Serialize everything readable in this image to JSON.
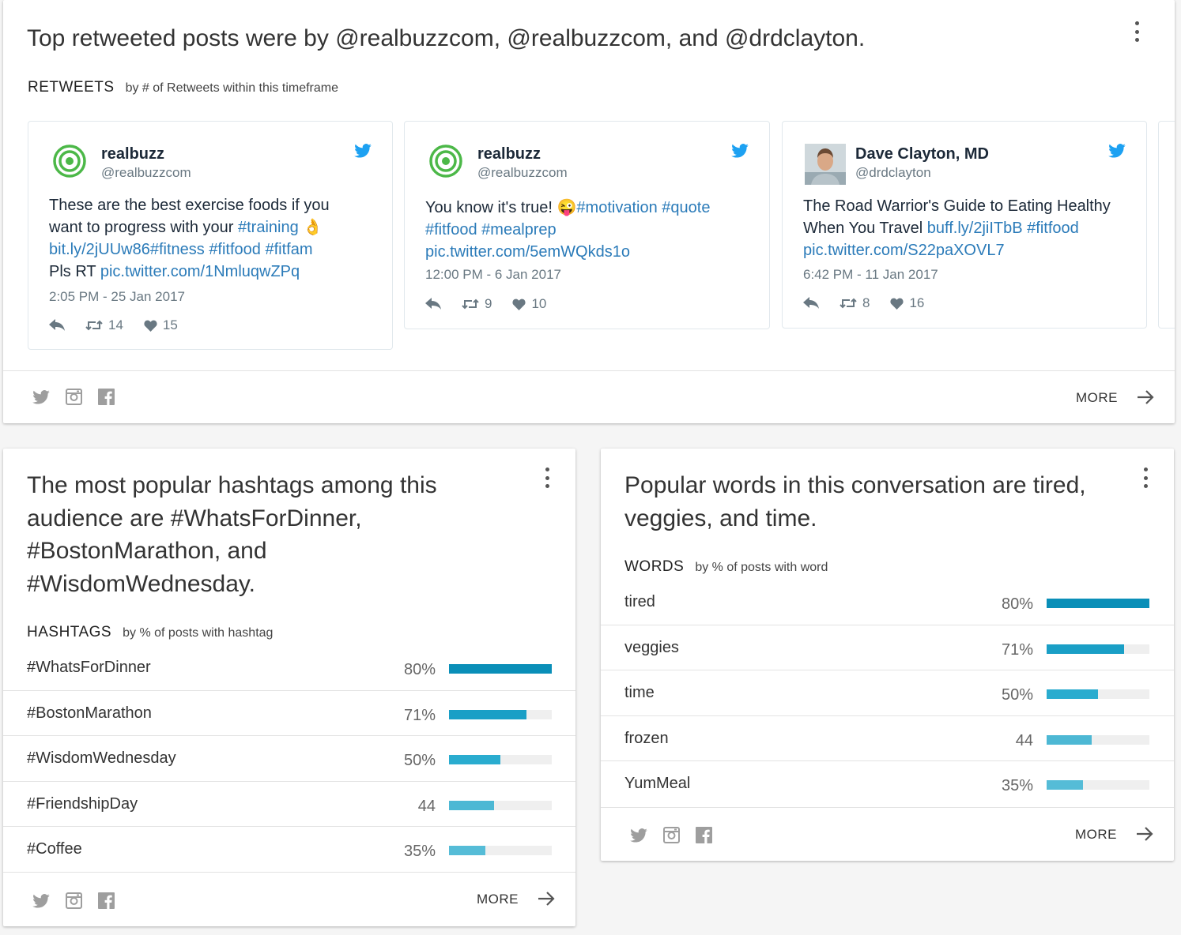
{
  "top_card": {
    "title": "Top retweeted posts were by @realbuzzcom, @realbuzzcom, and @drdclayton.",
    "section_label": "RETWEETS",
    "section_sub": "by # of Retweets within this timeframe",
    "more_label": "MORE",
    "tweets": [
      {
        "name": "realbuzz",
        "handle": "@realbuzzcom",
        "text_plain_1": "These are the best exercise foods if you want to progress with your ",
        "link_1": "#training",
        "emoji": "👌",
        "link_2": "bit.ly/2jUUw86#fitness",
        "link_3": "#fitfood",
        "link_4": "#fitfam",
        "text_plain_2": "Pls RT ",
        "link_5": "pic.twitter.com/1NmluqwZPq",
        "time": "2:05 PM - 25 Jan 2017",
        "retweets": "14",
        "likes": "15"
      },
      {
        "name": "realbuzz",
        "handle": "@realbuzzcom",
        "text_plain_1": "You know it's true! ",
        "emoji": "😜",
        "link_1": "#motivation",
        "link_2": "#quote",
        "link_3": "#fitfood",
        "link_4": "#mealprep",
        "link_5": "pic.twitter.com/5emWQkds1o",
        "time": "12:00 PM - 6 Jan 2017",
        "retweets": "9",
        "likes": "10"
      },
      {
        "name": "Dave Clayton, MD",
        "handle": "@drdclayton",
        "text_plain_1": "The Road Warrior's Guide to Eating Healthy When You Travel ",
        "link_1": "buff.ly/2jiITbB",
        "link_2": "#fitfood",
        "link_3": "pic.twitter.com/S22paXOVL7",
        "time": "6:42 PM - 11 Jan 2017",
        "retweets": "8",
        "likes": "16"
      }
    ]
  },
  "hashtags_card": {
    "title": "The most popular hashtags among this audience are #WhatsForDinner, #BostonMarathon, and #WisdomWednesday.",
    "section_label": "HASHTAGS",
    "section_sub": "by % of posts with hashtag",
    "more_label": "MORE",
    "rows": [
      {
        "label": "#WhatsForDinner",
        "pct": "80%",
        "value": 1.0,
        "color": "#0a8fb8"
      },
      {
        "label": "#BostonMarathon",
        "pct": "71%",
        "value": 0.75,
        "color": "#1a9fc6"
      },
      {
        "label": "#WisdomWednesday",
        "pct": "50%",
        "value": 0.5,
        "color": "#2aaccf"
      },
      {
        "label": "#FriendshipDay",
        "pct": "44",
        "value": 0.44,
        "color": "#4db8d4"
      },
      {
        "label": "#Coffee",
        "pct": "35%",
        "value": 0.35,
        "color": "#55bcd7"
      }
    ]
  },
  "words_card": {
    "title": "Popular words in this conversation are tired, veggies, and time.",
    "section_label": "WORDS",
    "section_sub": "by % of posts with word",
    "more_label": "MORE",
    "rows": [
      {
        "label": "tired",
        "pct": "80%",
        "value": 1.0,
        "color": "#0a8fb8"
      },
      {
        "label": "veggies",
        "pct": "71%",
        "value": 0.75,
        "color": "#1a9fc6"
      },
      {
        "label": "time",
        "pct": "50%",
        "value": 0.5,
        "color": "#2aaccf"
      },
      {
        "label": "frozen",
        "pct": "44",
        "value": 0.44,
        "color": "#4db8d4"
      },
      {
        "label": "YumMeal",
        "pct": "35%",
        "value": 0.35,
        "color": "#55bcd7"
      }
    ]
  }
}
